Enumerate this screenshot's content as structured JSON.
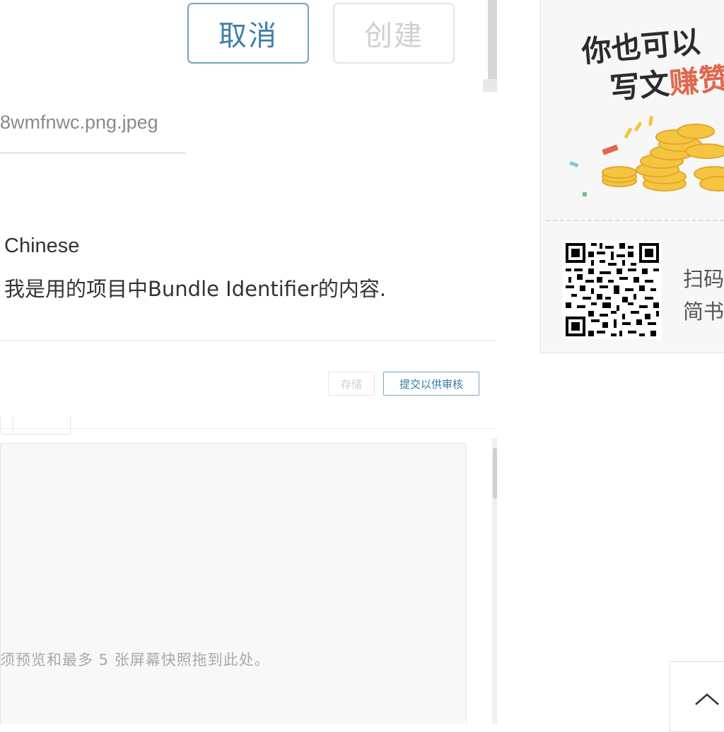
{
  "dialog": {
    "cancel_label": "取消",
    "create_label": "创建",
    "filename": "8wmfnwc.png.jpeg"
  },
  "localization": {
    "language": "Chinese",
    "text": "我是用的项目中Bundle Identifier的内容."
  },
  "actions": {
    "store_label": "存储",
    "submit_label": "提交以供审核"
  },
  "media": {
    "drop_hint": "须预览和最多 5 张屏幕快照拖到此处。"
  },
  "ad": {
    "headline_line1": "你也可以",
    "headline_line2_prefix": "写文",
    "headline_line2_accent": "赚赞",
    "scan_line1": "扫码",
    "scan_line2": "简书",
    "accent_color": "#e0684e",
    "coin_color": "#f5c542"
  },
  "icons": {
    "back_to_top": "chevron-up-icon"
  }
}
